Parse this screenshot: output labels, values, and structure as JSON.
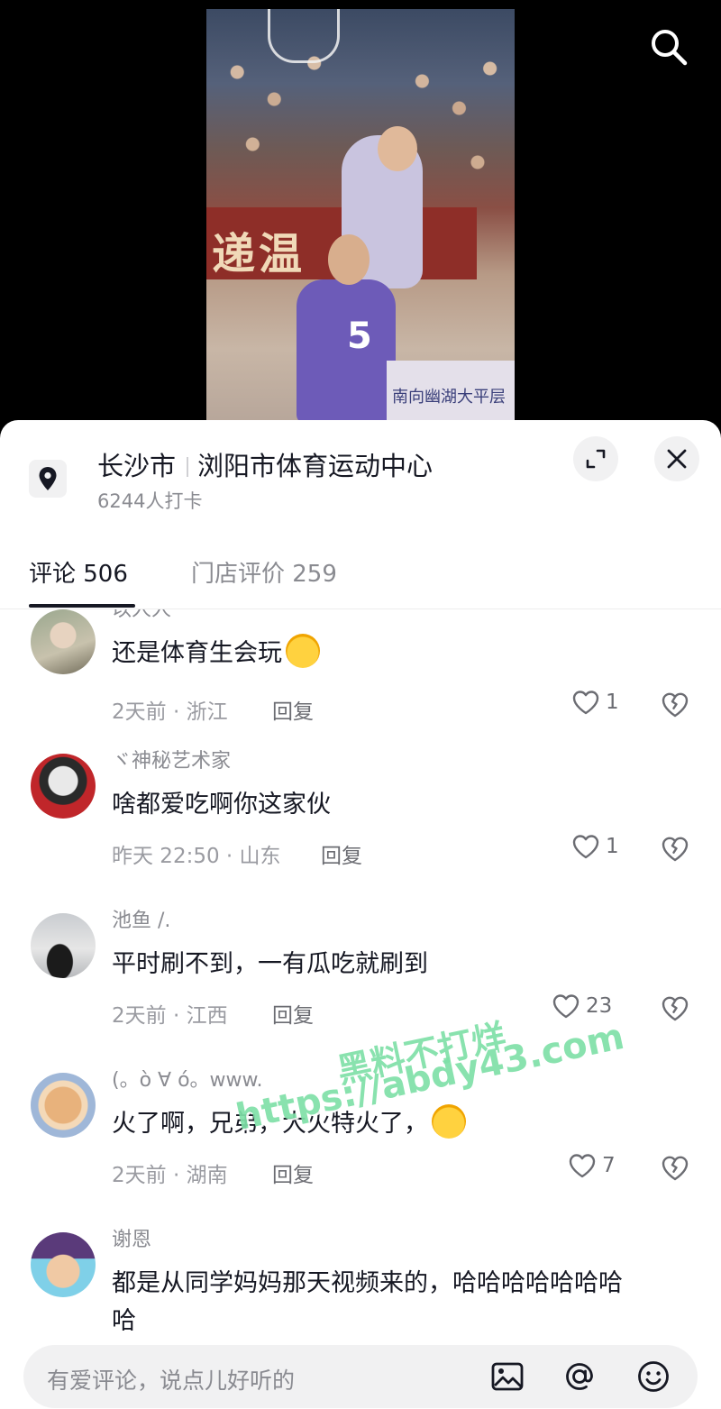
{
  "video": {
    "banner_text": "递温",
    "jersey_number": "5",
    "board_text": "南向幽湖大平层"
  },
  "location": {
    "city": "长沙市",
    "venue": "浏阳市体育运动中心",
    "checkins": "6244人打卡"
  },
  "tabs": [
    {
      "label": "评论 506",
      "active": true
    },
    {
      "label": "门店评价 259",
      "active": false
    }
  ],
  "comments": [
    {
      "user": "以人人",
      "text": "还是体育生会玩",
      "emoji": "smirk-emoji",
      "meta": "2天前 · 浙江",
      "reply": "回复",
      "likes": "1"
    },
    {
      "user": "ヾ神秘艺术家",
      "text": "啥都爱吃啊你这家伙",
      "meta": "昨天 22:50 · 山东",
      "reply": "回复",
      "likes": "1"
    },
    {
      "user": "池鱼 /.",
      "text": "平时刷不到，一有瓜吃就刷到",
      "meta": "2天前 · 江西",
      "reply": "回复",
      "likes": "23"
    },
    {
      "user": "(。ò ∀ ó。www.",
      "text": "火了啊，兄弟，大火特火了，",
      "emoji": "laugh-cry-emoji",
      "meta": "2天前 · 湖南",
      "reply": "回复",
      "likes": "7"
    },
    {
      "user": "谢恩",
      "text": "都是从同学妈妈那天视频来的，哈哈哈哈哈哈哈",
      "text_line2": "哈"
    }
  ],
  "watermark": {
    "line1": "黑料不打烊",
    "line2": "https://abdy43.com"
  },
  "input": {
    "placeholder": "有爱评论，说点儿好听的"
  },
  "colors": {
    "watermark": "#7fe0a8",
    "text_primary": "#161823",
    "text_secondary": "#8a8b91"
  }
}
